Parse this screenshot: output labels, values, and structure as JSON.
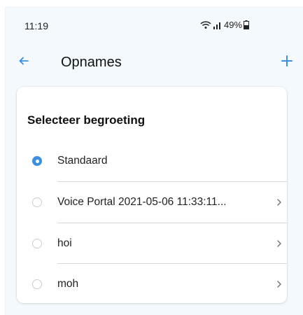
{
  "status": {
    "time": "11:19",
    "battery": "49%"
  },
  "appbar": {
    "title": "Opnames",
    "back_icon": "arrow-left-icon",
    "add_icon": "plus-icon"
  },
  "card": {
    "title": "Selecteer begroeting",
    "options": [
      {
        "label": "Standaard",
        "selected": true,
        "has_chevron": false
      },
      {
        "label": "Voice Portal 2021-05-06 11:33:11...",
        "selected": false,
        "has_chevron": true
      },
      {
        "label": "hoi",
        "selected": false,
        "has_chevron": true
      },
      {
        "label": "moh",
        "selected": false,
        "has_chevron": true
      }
    ]
  },
  "colors": {
    "accent": "#3b8fe0",
    "background": "#f3f9fc",
    "card": "#ffffff"
  }
}
